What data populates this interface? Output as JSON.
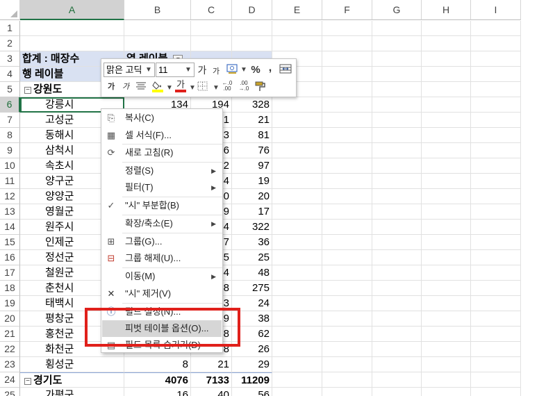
{
  "columns": [
    "A",
    "B",
    "C",
    "D",
    "E",
    "F",
    "G",
    "H",
    "I"
  ],
  "rows": [
    {
      "n": "1",
      "a": "",
      "b": "",
      "c": "",
      "d": ""
    },
    {
      "n": "2",
      "a": "",
      "b": "",
      "c": "",
      "d": ""
    },
    {
      "n": "3",
      "a": "합계 : 매장수",
      "b": "열 레이블",
      "c": "",
      "d": ""
    },
    {
      "n": "4",
      "a": "행 레이블",
      "b": "",
      "c": "",
      "d": ""
    },
    {
      "n": "5",
      "a": "강원도",
      "b": "",
      "c": "",
      "d": ""
    },
    {
      "n": "6",
      "a": "강릉시",
      "b": "134",
      "c": "194",
      "d": "328"
    },
    {
      "n": "7",
      "a": "고성군",
      "b": "",
      "c": "1",
      "d": "21"
    },
    {
      "n": "8",
      "a": "동해시",
      "b": "",
      "c": "3",
      "d": "81"
    },
    {
      "n": "9",
      "a": "삼척시",
      "b": "",
      "c": "6",
      "d": "76"
    },
    {
      "n": "10",
      "a": "속초시",
      "b": "",
      "c": "2",
      "d": "97"
    },
    {
      "n": "11",
      "a": "양구군",
      "b": "",
      "c": "4",
      "d": "19"
    },
    {
      "n": "12",
      "a": "양양군",
      "b": "",
      "c": "0",
      "d": "20"
    },
    {
      "n": "13",
      "a": "영월군",
      "b": "",
      "c": "9",
      "d": "17"
    },
    {
      "n": "14",
      "a": "원주시",
      "b": "",
      "c": "4",
      "d": "322"
    },
    {
      "n": "15",
      "a": "인제군",
      "b": "",
      "c": "7",
      "d": "36"
    },
    {
      "n": "16",
      "a": "정선군",
      "b": "",
      "c": "5",
      "d": "25"
    },
    {
      "n": "17",
      "a": "철원군",
      "b": "",
      "c": "4",
      "d": "48"
    },
    {
      "n": "18",
      "a": "춘천시",
      "b": "",
      "c": "8",
      "d": "275"
    },
    {
      "n": "19",
      "a": "태백시",
      "b": "",
      "c": "3",
      "d": "24"
    },
    {
      "n": "20",
      "a": "평창군",
      "b": "",
      "c": "9",
      "d": "38"
    },
    {
      "n": "21",
      "a": "홍천군",
      "b": "",
      "c": "8",
      "d": "62"
    },
    {
      "n": "22",
      "a": "화천군",
      "b": "",
      "c": "8",
      "d": "26"
    },
    {
      "n": "23",
      "a": "횡성군",
      "b": "8",
      "c": "21",
      "d": "29"
    },
    {
      "n": "24",
      "a": "경기도",
      "b": "4076",
      "c": "7133",
      "d": "11209"
    },
    {
      "n": "25",
      "a": "가평군",
      "b": "16",
      "c": "40",
      "d": "56"
    }
  ],
  "minibar": {
    "font_name": "맑은 고딕",
    "font_size": "11",
    "grow_font": "가",
    "shrink_font": "가",
    "percent": "%",
    "comma": ",",
    "bold": "가",
    "italic": "가",
    "font_color_glyph": "가",
    "inc_decimal": "←.0\n.00",
    "dec_decimal": ".00\n→.0"
  },
  "menu": {
    "items": [
      {
        "label": "복사(C)",
        "icon": "copy-icon"
      },
      {
        "label": "셀 서식(F)...",
        "icon": "format-cells-icon"
      },
      {
        "label": "새로 고침(R)",
        "icon": "refresh-icon"
      },
      {
        "label": "정렬(S)",
        "icon": ""
      },
      {
        "label": "필터(T)",
        "icon": ""
      },
      {
        "label": "\"시\" 부분합(B)",
        "icon": "check-icon"
      },
      {
        "label": "확장/축소(E)",
        "icon": ""
      },
      {
        "label": "그룹(G)...",
        "icon": "group-icon"
      },
      {
        "label": "그룹 해제(U)...",
        "icon": "ungroup-icon"
      },
      {
        "label": "이동(M)",
        "icon": ""
      },
      {
        "label": "\"시\" 제거(V)",
        "icon": "remove-icon"
      },
      {
        "label": "필드 설정(N)...",
        "icon": "field-settings-icon"
      },
      {
        "label": "피벗 테이블 옵션(O)...",
        "icon": ""
      },
      {
        "label": "필드 목록 숨기기(D)",
        "icon": "field-list-icon"
      }
    ]
  },
  "colors": {
    "accent": "#217346",
    "pivot_header": "#d9e1f2",
    "highlight_box": "#e0201b",
    "menu_hover": "#d6d6d6"
  }
}
